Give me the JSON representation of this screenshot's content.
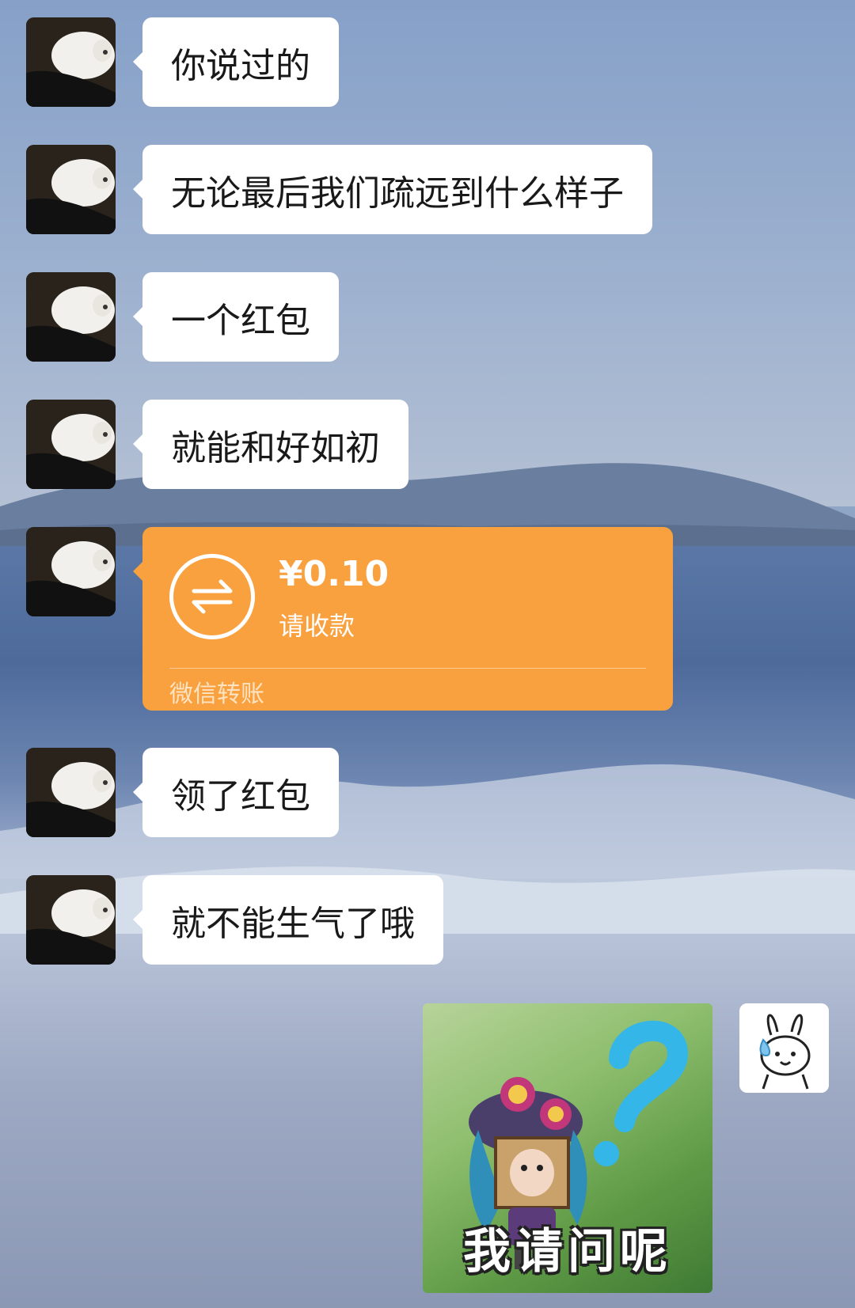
{
  "messages": [
    {
      "type": "text",
      "sender": "other",
      "text": "你说过的"
    },
    {
      "type": "text",
      "sender": "other",
      "text": "无论最后我们疏远到什么样子"
    },
    {
      "type": "text",
      "sender": "other",
      "text": "一个红包"
    },
    {
      "type": "text",
      "sender": "other",
      "text": "就能和好如初"
    },
    {
      "type": "transfer",
      "sender": "other",
      "amount": "¥0.10",
      "status": "请收款",
      "label": "微信转账",
      "color": "#f9a03f"
    },
    {
      "type": "text",
      "sender": "other",
      "text": "领了红包"
    },
    {
      "type": "text",
      "sender": "other",
      "text": "就不能生气了哦"
    },
    {
      "type": "sticker",
      "sender": "self",
      "caption": "我请问呢"
    }
  ],
  "icons": {
    "other_avatar": "white-cat-avatar",
    "self_avatar": "bunny-sweat-avatar",
    "transfer": "transfer-arrows-icon",
    "sticker_mark": "question-mark-icon"
  }
}
